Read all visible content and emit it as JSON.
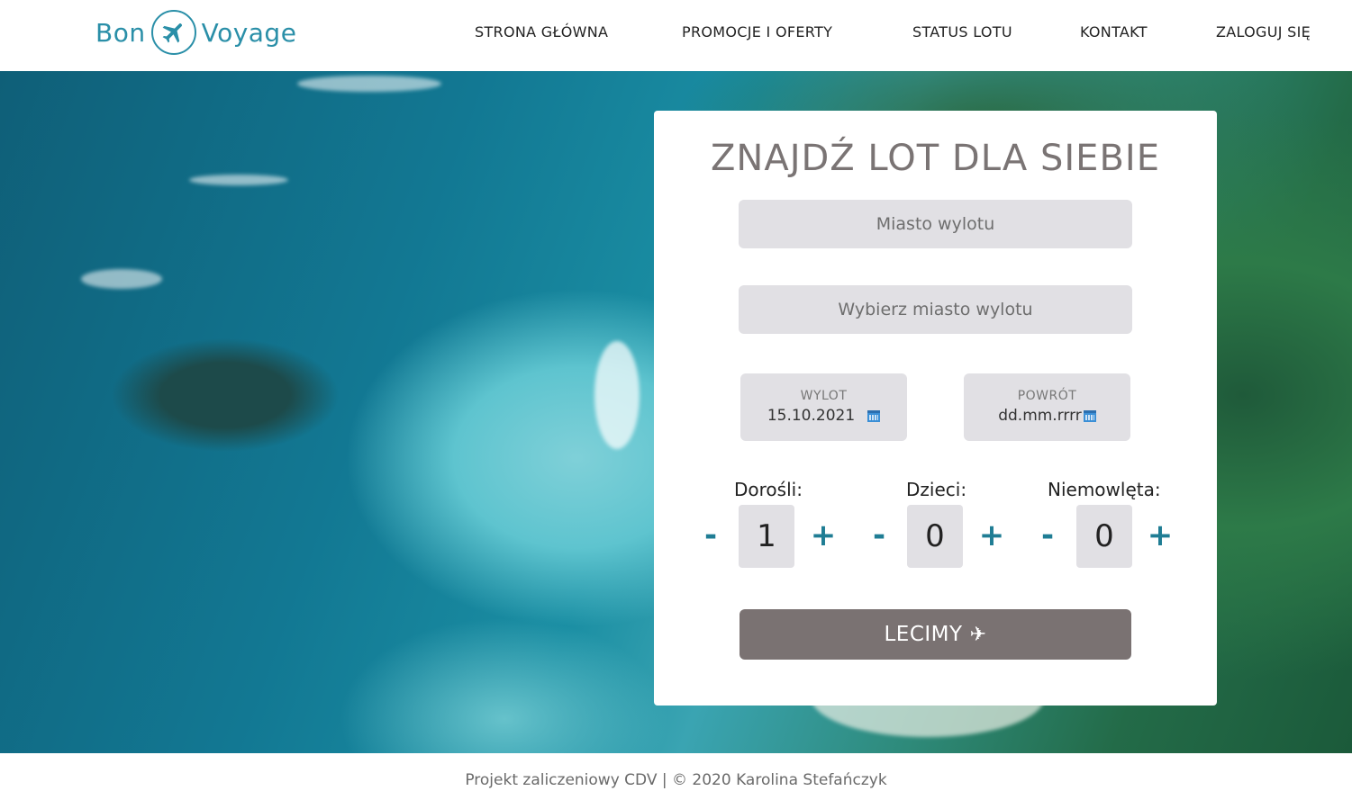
{
  "brand": {
    "left": "Bon",
    "right": "Voyage",
    "color": "#2a8fa8"
  },
  "nav": [
    {
      "label": "STRONA GŁÓWNA"
    },
    {
      "label": "PROMOCJE I OFERTY"
    },
    {
      "label": "STATUS LOTU"
    },
    {
      "label": "KONTAKT"
    },
    {
      "label": "ZALOGUJ SIĘ"
    }
  ],
  "search": {
    "title": "ZNAJDŹ LOT DLA SIEBIE",
    "from_placeholder": "Miasto wylotu",
    "to_placeholder": "Wybierz miasto wylotu",
    "departure": {
      "label": "WYLOT",
      "value": "15.10.2021"
    },
    "return": {
      "label": "POWRÓT",
      "value": "dd.mm.rrrr"
    },
    "passengers": [
      {
        "label": "Dorośli:",
        "count": "1",
        "minus": "-",
        "plus": "+"
      },
      {
        "label": "Dzieci:",
        "count": "0",
        "minus": "-",
        "plus": "+"
      },
      {
        "label": "Niemowlęta:",
        "count": "0",
        "minus": "-",
        "plus": "+"
      }
    ],
    "submit_label": "LECIMY",
    "submit_icon": "✈"
  },
  "footer": {
    "text": "Projekt zaliczeniowy CDV | © 2020 Karolina Stefańczyk"
  },
  "colors": {
    "accent": "#1f7d94",
    "button": "#7a7272",
    "field": "#e1e0e4"
  }
}
